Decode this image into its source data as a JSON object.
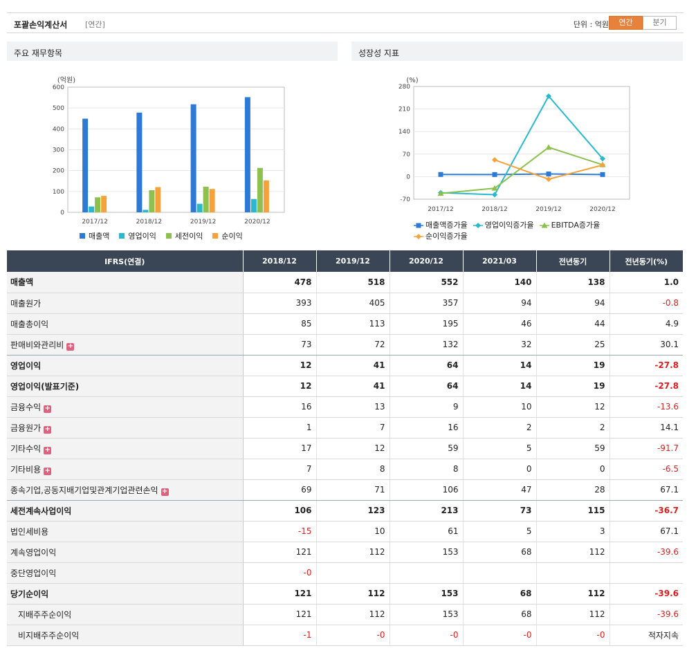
{
  "header": {
    "title": "포괄손익계산서",
    "subtitle": "[연간]",
    "unit_label": "단위 : 억원",
    "tabs": [
      {
        "label": "연간",
        "active": true
      },
      {
        "label": "분기",
        "active": false
      }
    ]
  },
  "panels": {
    "left_title": "주요 재무항목",
    "right_title": "성장성 지표"
  },
  "colors": {
    "accent": "#e8823b",
    "table_header": "#3a4656",
    "negative": "#d81e1e"
  },
  "chart_data": [
    {
      "type": "bar",
      "yunit": "(억원)",
      "categories": [
        "2017/12",
        "2018/12",
        "2019/12",
        "2020/12"
      ],
      "ylim": [
        0,
        600
      ],
      "yticks": [
        0,
        100,
        200,
        300,
        400,
        500,
        600
      ],
      "grid": true,
      "legend_position": "bottom",
      "series": [
        {
          "name": "매출액",
          "color": "#2d7ad6",
          "values": [
            449,
            478,
            518,
            552
          ]
        },
        {
          "name": "영업이익",
          "color": "#29b8cc",
          "values": [
            28,
            12,
            41,
            64
          ]
        },
        {
          "name": "세전이익",
          "color": "#8cc04f",
          "values": [
            72,
            106,
            123,
            213
          ]
        },
        {
          "name": "순이익",
          "color": "#f5a23a",
          "values": [
            79,
            121,
            112,
            153
          ]
        }
      ]
    },
    {
      "type": "line",
      "yunit": "(%)",
      "categories": [
        "2017/12",
        "2018/12",
        "2019/12",
        "2020/12"
      ],
      "ylim": [
        -70,
        280
      ],
      "yticks": [
        -70,
        0,
        70,
        140,
        210,
        280
      ],
      "grid": true,
      "legend_position": "bottom",
      "series": [
        {
          "name": "매출액증가율",
          "color": "#2d7ad6",
          "marker": "square",
          "values": [
            6.8,
            6.5,
            8.4,
            6.6
          ]
        },
        {
          "name": "영업이익증가율",
          "color": "#29b8cc",
          "marker": "diamond",
          "values": [
            -50,
            -56,
            250,
            56
          ]
        },
        {
          "name": "EBITDA증가율",
          "color": "#8cc04f",
          "marker": "triangle",
          "values": [
            -52,
            -36,
            91,
            37
          ]
        },
        {
          "name": "순이익증가율",
          "color": "#f5a23a",
          "marker": "diamond",
          "values": [
            null,
            52,
            -8,
            36
          ]
        }
      ]
    }
  ],
  "table": {
    "headers": [
      "IFRS(연결)",
      "2018/12",
      "2019/12",
      "2020/12",
      "2021/03",
      "전년동기",
      "전년동기(%)"
    ],
    "rows": [
      {
        "label": "매출액",
        "bold": true,
        "sep": false,
        "plus": false,
        "indent": false,
        "cells": [
          "478",
          "518",
          "552",
          "140",
          "138",
          "1.0"
        ]
      },
      {
        "label": "매출원가",
        "bold": false,
        "sep": false,
        "plus": false,
        "indent": false,
        "cells": [
          "393",
          "405",
          "357",
          "94",
          "94",
          "-0.8"
        ]
      },
      {
        "label": "매출총이익",
        "bold": false,
        "sep": false,
        "plus": false,
        "indent": false,
        "cells": [
          "85",
          "113",
          "195",
          "46",
          "44",
          "4.9"
        ]
      },
      {
        "label": "판매비와관리비",
        "bold": false,
        "sep": true,
        "plus": true,
        "indent": false,
        "cells": [
          "73",
          "72",
          "132",
          "32",
          "25",
          "30.1"
        ]
      },
      {
        "label": "영업이익",
        "bold": true,
        "sep": false,
        "plus": false,
        "indent": false,
        "cells": [
          "12",
          "41",
          "64",
          "14",
          "19",
          "-27.8"
        ]
      },
      {
        "label": "영업이익(발표기준)",
        "bold": true,
        "sep": false,
        "plus": false,
        "indent": false,
        "cells": [
          "12",
          "41",
          "64",
          "14",
          "19",
          "-27.8"
        ]
      },
      {
        "label": "금융수익",
        "bold": false,
        "sep": false,
        "plus": true,
        "indent": false,
        "cells": [
          "16",
          "13",
          "9",
          "10",
          "12",
          "-13.6"
        ]
      },
      {
        "label": "금융원가",
        "bold": false,
        "sep": false,
        "plus": true,
        "indent": false,
        "cells": [
          "1",
          "7",
          "16",
          "2",
          "2",
          "14.1"
        ]
      },
      {
        "label": "기타수익",
        "bold": false,
        "sep": false,
        "plus": true,
        "indent": false,
        "cells": [
          "17",
          "12",
          "59",
          "5",
          "59",
          "-91.7"
        ]
      },
      {
        "label": "기타비용",
        "bold": false,
        "sep": false,
        "plus": true,
        "indent": false,
        "cells": [
          "7",
          "8",
          "8",
          "0",
          "0",
          "-6.5"
        ]
      },
      {
        "label": "종속기업,공동지배기업및관계기업관련손익",
        "bold": false,
        "sep": true,
        "plus": true,
        "indent": false,
        "cells": [
          "69",
          "71",
          "106",
          "47",
          "28",
          "67.1"
        ]
      },
      {
        "label": "세전계속사업이익",
        "bold": true,
        "sep": false,
        "plus": false,
        "indent": false,
        "cells": [
          "106",
          "123",
          "213",
          "73",
          "115",
          "-36.7"
        ]
      },
      {
        "label": "법인세비용",
        "bold": false,
        "sep": false,
        "plus": false,
        "indent": false,
        "cells": [
          "-15",
          "10",
          "61",
          "5",
          "3",
          "67.1"
        ]
      },
      {
        "label": "계속영업이익",
        "bold": false,
        "sep": false,
        "plus": false,
        "indent": false,
        "cells": [
          "121",
          "112",
          "153",
          "68",
          "112",
          "-39.6"
        ]
      },
      {
        "label": "중단영업이익",
        "bold": false,
        "sep": false,
        "plus": false,
        "indent": false,
        "cells": [
          "-0",
          "",
          "",
          "",
          "",
          ""
        ]
      },
      {
        "label": "당기순이익",
        "bold": true,
        "sep": false,
        "plus": false,
        "indent": false,
        "cells": [
          "121",
          "112",
          "153",
          "68",
          "112",
          "-39.6"
        ]
      },
      {
        "label": "지배주주순이익",
        "bold": false,
        "sep": false,
        "plus": false,
        "indent": true,
        "cells": [
          "121",
          "112",
          "153",
          "68",
          "112",
          "-39.6"
        ]
      },
      {
        "label": "비지배주주순이익",
        "bold": false,
        "sep": false,
        "plus": false,
        "indent": true,
        "cells": [
          "-1",
          "-0",
          "-0",
          "-0",
          "-0",
          "적자지속"
        ]
      }
    ]
  }
}
